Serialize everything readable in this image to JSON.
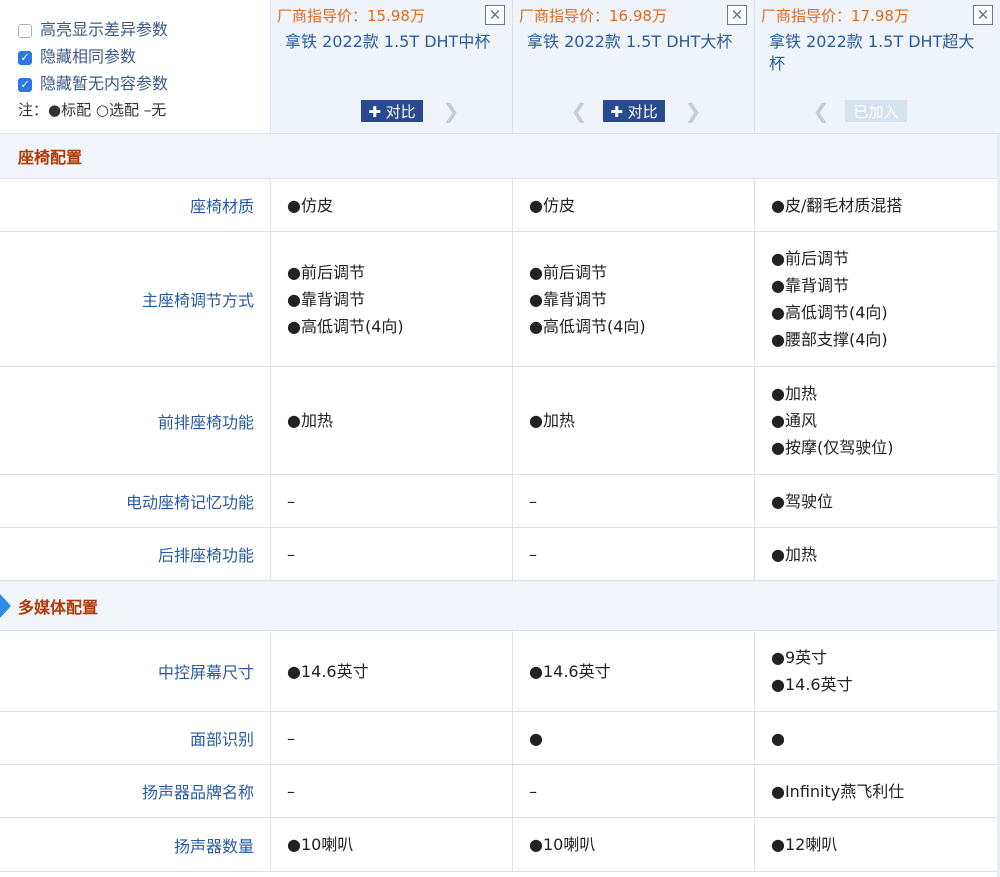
{
  "options": {
    "items": [
      {
        "label": "高亮显示差异参数",
        "checked": false
      },
      {
        "label": "隐藏相同参数",
        "checked": true
      },
      {
        "label": "隐藏暂无内容参数",
        "checked": true
      }
    ],
    "legend": "注：●标配 ○选配 –无"
  },
  "models": [
    {
      "price": "厂商指导价：15.98万",
      "name": "拿铁 2022款 1.5T DHT中杯",
      "action": "✚ 对比",
      "state": "compare",
      "prev": false,
      "next": true
    },
    {
      "price": "厂商指导价：16.98万",
      "name": "拿铁 2022款 1.5T DHT大杯",
      "action": "✚ 对比",
      "state": "compare",
      "prev": true,
      "next": true
    },
    {
      "price": "厂商指导价：17.98万",
      "name": "拿铁 2022款 1.5T DHT超大杯",
      "action": "已加入",
      "state": "added",
      "prev": true,
      "next": false
    }
  ],
  "close_icon": "close-icon",
  "sections": [
    {
      "title": "座椅配置",
      "rows": [
        {
          "label": "座椅材质",
          "values": [
            [
              "●仿皮"
            ],
            [
              "●仿皮"
            ],
            [
              "●皮/翻毛材质混搭"
            ]
          ]
        },
        {
          "label": "主座椅调节方式",
          "values": [
            [
              "●前后调节",
              "●靠背调节",
              "●高低调节(4向)"
            ],
            [
              "●前后调节",
              "●靠背调节",
              "●高低调节(4向)"
            ],
            [
              "●前后调节",
              "●靠背调节",
              "●高低调节(4向)",
              "●腰部支撑(4向)"
            ]
          ]
        },
        {
          "label": "前排座椅功能",
          "values": [
            [
              "●加热"
            ],
            [
              "●加热"
            ],
            [
              "●加热",
              "●通风",
              "●按摩(仅驾驶位)"
            ]
          ]
        },
        {
          "label": "电动座椅记忆功能",
          "values": [
            [
              "–"
            ],
            [
              "–"
            ],
            [
              "●驾驶位"
            ]
          ]
        },
        {
          "label": "后排座椅功能",
          "values": [
            [
              "–"
            ],
            [
              "–"
            ],
            [
              "●加热"
            ]
          ]
        }
      ]
    },
    {
      "title": "多媒体配置",
      "rows": [
        {
          "label": "中控屏幕尺寸",
          "values": [
            [
              "●14.6英寸"
            ],
            [
              "●14.6英寸"
            ],
            [
              "●9英寸",
              "●14.6英寸"
            ]
          ]
        },
        {
          "label": "面部识别",
          "values": [
            [
              "–"
            ],
            [
              "●"
            ],
            [
              "●"
            ]
          ]
        },
        {
          "label": "扬声器品牌名称",
          "values": [
            [
              "–"
            ],
            [
              "–"
            ],
            [
              "●Infinity燕飞利仕"
            ]
          ]
        },
        {
          "label": "扬声器数量",
          "values": [
            [
              "●10喇叭"
            ],
            [
              "●10喇叭"
            ],
            [
              "●12喇叭"
            ]
          ]
        }
      ]
    }
  ],
  "colors": {
    "section_title": "#b23a0a",
    "label": "#2a5b9e",
    "price": "#e06a1a",
    "compare_button": "#2a4a8f",
    "header_bg": "#eef4fa",
    "section_bg": "#f1f4f8"
  }
}
